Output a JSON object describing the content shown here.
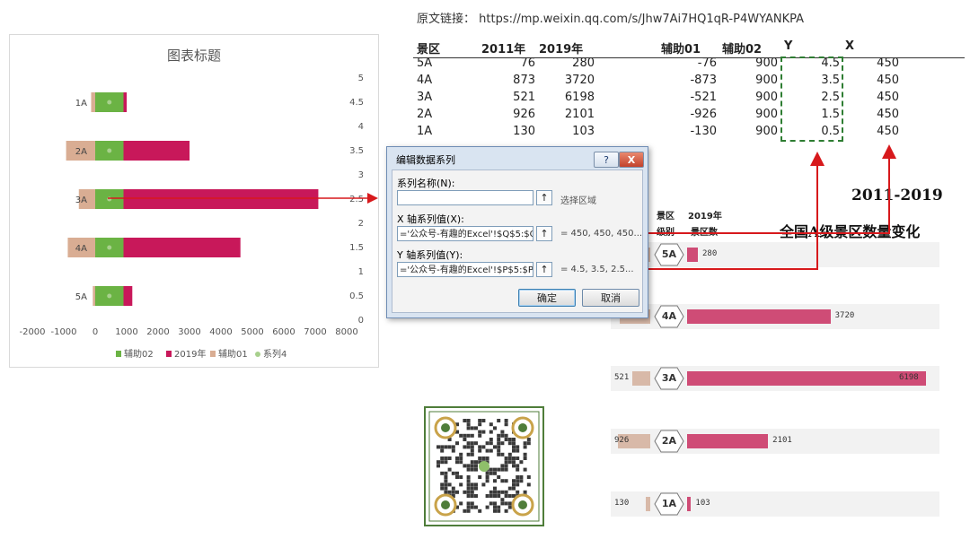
{
  "source_url_line": "原文链接： https://mp.weixin.qq.com/s/Jhw7Ai7HQ1qR-P4WYANKPA",
  "chart_data": {
    "type": "bar",
    "title": "图表标题",
    "categories": [
      "5A",
      "4A",
      "3A",
      "2A",
      "1A"
    ],
    "y_positions": [
      0.5,
      1.5,
      2.5,
      3.5,
      4.5
    ],
    "series": [
      {
        "name": "辅助02",
        "values": [
          900,
          900,
          900,
          900,
          900
        ],
        "color": "#6bb344"
      },
      {
        "name": "2019年",
        "values": [
          280,
          3720,
          6198,
          2101,
          103
        ],
        "color": "#c8185a"
      },
      {
        "name": "辅助01",
        "values": [
          -76,
          -873,
          -521,
          -926,
          -130
        ],
        "color": "#d9ad93"
      },
      {
        "name": "系列4",
        "x": [
          450,
          450,
          450,
          450,
          450
        ],
        "y": [
          0.5,
          1.5,
          2.5,
          3.5,
          4.5
        ],
        "color": "#a8d08d"
      }
    ],
    "xlim": [
      -2000,
      8000
    ],
    "xticks": [
      "-2000",
      "-1000",
      "0",
      "1000",
      "2000",
      "3000",
      "4000",
      "5000",
      "6000",
      "7000",
      "8000"
    ],
    "ylim": [
      0,
      5
    ],
    "yticks": [
      "0",
      "0.5",
      "1",
      "1.5",
      "2",
      "2.5",
      "3",
      "3.5",
      "4",
      "4.5",
      "5"
    ],
    "legend_position": "bottom",
    "grid": false
  },
  "table": {
    "headers": [
      "景区",
      "2011年",
      "2019年",
      "辅助01",
      "辅助02",
      "Y",
      "X"
    ],
    "rows": [
      [
        "5A",
        "76",
        "280",
        "-76",
        "900",
        "4.5",
        "450"
      ],
      [
        "4A",
        "873",
        "3720",
        "-873",
        "900",
        "3.5",
        "450"
      ],
      [
        "3A",
        "521",
        "6198",
        "-521",
        "900",
        "2.5",
        "450"
      ],
      [
        "2A",
        "926",
        "2101",
        "-926",
        "900",
        "1.5",
        "450"
      ],
      [
        "1A",
        "130",
        "103",
        "-130",
        "900",
        "0.5",
        "450"
      ]
    ]
  },
  "dialog": {
    "title": "编辑数据系列",
    "help_label": "?",
    "close_label": "X",
    "name_label": "系列名称(N):",
    "name_value": "",
    "select_range_label": "选择区域",
    "x_label": "X 轴系列值(X):",
    "x_value": "='公众号-有趣的Excel'!$Q$5:$Q",
    "x_preview": "= 450, 450, 450...",
    "y_label": "Y 轴系列值(Y):",
    "y_value": "='公众号-有趣的Excel'!$P$5:$P",
    "y_preview": "= 4.5, 3.5, 2.5...",
    "collapse_icon": "↑",
    "ok_label": "确定",
    "cancel_label": "取消"
  },
  "right_panel": {
    "title_line1": "2011-2019",
    "title_line2": "全国A级景区数量变化",
    "col_level_1": "景区",
    "col_level_2": "级别",
    "col_count_1": "2019年",
    "col_count_2": "景区数",
    "rows": [
      {
        "level": "5A",
        "left_label": "",
        "right_label": "280",
        "v2011": 76,
        "v2019": 280
      },
      {
        "level": "4A",
        "left_label": "873",
        "right_label": "3720",
        "v2011": 873,
        "v2019": 3720
      },
      {
        "level": "3A",
        "left_label": "521",
        "right_label": "6198",
        "v2011": 521,
        "v2019": 6198
      },
      {
        "level": "2A",
        "left_label": "926",
        "right_label": "2101",
        "v2011": 926,
        "v2019": 2101
      },
      {
        "level": "1A",
        "left_label": "130",
        "right_label": "103",
        "v2011": 130,
        "v2019": 103
      }
    ]
  },
  "colors": {
    "bar_pink": "#c8185a",
    "bar_green": "#6bb344",
    "bar_tan": "#d9ad93",
    "arrow_red": "#d7191c",
    "qr_green": "#4f7d3a"
  },
  "qr_icon": "qr-code-icon"
}
